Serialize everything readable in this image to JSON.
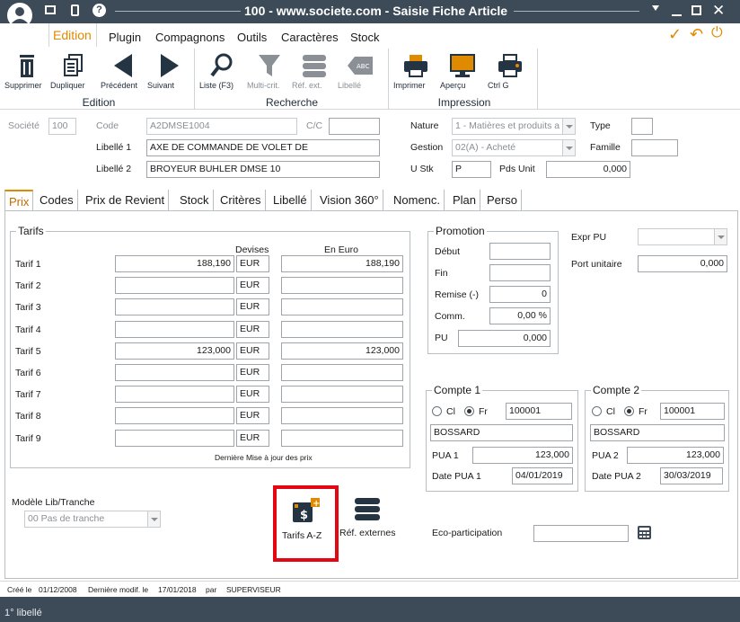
{
  "window": {
    "title": "100 - www.societe.com - Saisie Fiche Article",
    "icons": [
      "avatar-icon",
      "monitor-icon",
      "phone-icon",
      "help-icon",
      "pin-icon",
      "minimize-icon",
      "restore-icon",
      "close-icon"
    ]
  },
  "menu": {
    "items": [
      "Edition",
      "Plugin",
      "Compagnons",
      "Outils",
      "Caractères",
      "Stock"
    ],
    "right_icons": [
      "check-icon",
      "undo-icon",
      "power-icon"
    ]
  },
  "ribbon": {
    "edition": {
      "group": "Edition",
      "buttons": [
        "Supprimer",
        "Dupliquer",
        "Précédent",
        "Suivant"
      ]
    },
    "recherche": {
      "group": "Recherche",
      "buttons": [
        "Liste (F3)",
        "Multi-crit.",
        "Réf. ext.",
        "Libellé"
      ]
    },
    "impression": {
      "group": "Impression",
      "buttons": [
        "Imprimer",
        "Aperçu",
        "Ctrl G"
      ]
    }
  },
  "header": {
    "societe_label": "Société",
    "societe_value": "100",
    "code_label": "Code",
    "code_value": "A2DMSE1004",
    "cc_label": "C/C",
    "libelle1_label": "Libellé 1",
    "libelle1_value": "AXE DE COMMANDE DE VOLET DE",
    "libelle2_label": "Libellé 2",
    "libelle2_value": "BROYEUR BUHLER DMSE 10",
    "nature_label": "Nature",
    "nature_value": "1 - Matières et produits a",
    "gestion_label": "Gestion",
    "gestion_value": "02(A) - Acheté",
    "ustk_label": "U Stk",
    "ustk_value": "P",
    "pdsunit_label": "Pds Unit",
    "pdsunit_value": "0,000",
    "type_label": "Type",
    "famille_label": "Famille"
  },
  "tabs": [
    "Prix",
    "Codes",
    "Prix de Revient",
    "Stock",
    "Critères",
    "Libellé",
    "Vision 360°",
    "Nomenc.",
    "Plan",
    "Perso"
  ],
  "tarifs": {
    "title": "Tarifs",
    "devises_header": "Devises",
    "euro_header": "En Euro",
    "footer": "Dernière Mise à jour des prix",
    "rows": [
      {
        "label": "Tarif 1",
        "value": "188,190",
        "devise": "EUR",
        "euro": "188,190"
      },
      {
        "label": "Tarif 2",
        "value": "",
        "devise": "EUR",
        "euro": ""
      },
      {
        "label": "Tarif 3",
        "value": "",
        "devise": "EUR",
        "euro": ""
      },
      {
        "label": "Tarif 4",
        "value": "",
        "devise": "EUR",
        "euro": ""
      },
      {
        "label": "Tarif 5",
        "value": "123,000",
        "devise": "EUR",
        "euro": "123,000"
      },
      {
        "label": "Tarif 6",
        "value": "",
        "devise": "EUR",
        "euro": ""
      },
      {
        "label": "Tarif 7",
        "value": "",
        "devise": "EUR",
        "euro": ""
      },
      {
        "label": "Tarif 8",
        "value": "",
        "devise": "EUR",
        "euro": ""
      },
      {
        "label": "Tarif 9",
        "value": "",
        "devise": "EUR",
        "euro": ""
      }
    ]
  },
  "promotion": {
    "title": "Promotion",
    "debut_label": "Début",
    "fin_label": "Fin",
    "remise_label": "Remise (-)",
    "remise_value": "0",
    "comm_label": "Comm.",
    "comm_value": "0,00 %",
    "pu_label": "PU",
    "pu_value": "0,000"
  },
  "expr": {
    "expr_pu_label": "Expr PU",
    "port_unitaire_label": "Port unitaire",
    "port_unitaire_value": "0,000"
  },
  "compte1": {
    "title": "Compte 1",
    "cl_label": "Cl",
    "fr_label": "Fr",
    "code": "100001",
    "name": "BOSSARD",
    "pua_label": "PUA 1",
    "pua_value": "123,000",
    "date_label": "Date PUA 1",
    "date_value": "04/01/2019"
  },
  "compte2": {
    "title": "Compte 2",
    "cl_label": "Cl",
    "fr_label": "Fr",
    "code": "100001",
    "name": "BOSSARD",
    "pua_label": "PUA 2",
    "pua_value": "123,000",
    "date_label": "Date PUA 2",
    "date_value": "30/03/2019"
  },
  "modele": {
    "label": "Modèle Lib/Tranche",
    "value": "00 Pas de tranche"
  },
  "actions": {
    "tarifs_az": "Tarifs A-Z",
    "ref_externes": "Réf. externes",
    "eco_label": "Eco-participation",
    "highlight_color": "#e30613"
  },
  "status": {
    "cree_label": "Créé le",
    "cree_value": "01/12/2008",
    "modif_label": "Dernière modif. le",
    "modif_value": "17/01/2018",
    "par_label": "par",
    "par_value": "SUPERVISEUR"
  },
  "footer": {
    "text": "1° libellé"
  },
  "colors": {
    "titlebar": "#3d4a57",
    "accent": "#e08a00",
    "ribbon_icon": "#253443"
  }
}
